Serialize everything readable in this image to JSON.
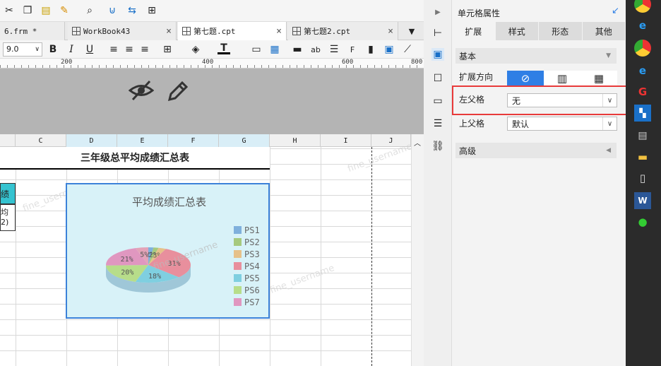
{
  "toolbar_top": {
    "icons": [
      "cut-icon",
      "copy-icon",
      "paste-icon",
      "format-brush-icon",
      "preview-icon",
      "bind-icon",
      "swap-icon",
      "zoom-icon"
    ]
  },
  "tabs": [
    {
      "label": "6.frm *"
    },
    {
      "label": "WorkBook43"
    },
    {
      "label": "第七题.cpt"
    },
    {
      "label": "第七题2.cpt"
    }
  ],
  "format_bar": {
    "font_size": "9.0",
    "bold": "B",
    "italic": "I",
    "underline": "U",
    "text_color": "T"
  },
  "ruler": {
    "marks": [
      "200",
      "400",
      "600",
      "800"
    ]
  },
  "columns": [
    "C",
    "D",
    "E",
    "F",
    "G",
    "H",
    "I",
    "J"
  ],
  "sheet": {
    "title": "三年级总平均成绩汇总表",
    "left_cell_a": "绩",
    "left_cell_b": "均",
    "left_cell_c": "2)"
  },
  "chart_data": {
    "type": "pie",
    "title": "平均成绩汇总表",
    "series": [
      {
        "name": "PS1",
        "value": 2,
        "label": "2%"
      },
      {
        "name": "PS2",
        "value": 2,
        "label": "2%"
      },
      {
        "name": "PS3",
        "value": 3,
        "label": "3%"
      },
      {
        "name": "PS4",
        "value": 31,
        "label": "31%"
      },
      {
        "name": "PS5",
        "value": 18,
        "label": "18%"
      },
      {
        "name": "PS6",
        "value": 20,
        "label": "20%"
      },
      {
        "name": "PS7",
        "value": 21,
        "label": "21%"
      },
      {
        "name": "",
        "value": 5,
        "label": "5%"
      }
    ],
    "colors": [
      "#7fb0dc",
      "#a6c97e",
      "#e6c18a",
      "#e88f9d",
      "#7fcfe0",
      "#b7dd8a",
      "#e097c0",
      "#e3a3b8"
    ],
    "legend": "right",
    "background": "#d8f2f8"
  },
  "panel": {
    "title": "单元格属性",
    "tabs": [
      "扩展",
      "样式",
      "形态",
      "其他"
    ],
    "section_basic": "基本",
    "expand_label": "扩展方向",
    "left_parent_label": "左父格",
    "left_parent_value": "无",
    "top_parent_label": "上父格",
    "top_parent_value": "默认",
    "section_advanced": "高级"
  },
  "watermark": "fine_username",
  "colors": {
    "selection": "#3c82d9",
    "highlight": "#e83a3a",
    "active_blue": "#2f7fe5"
  }
}
